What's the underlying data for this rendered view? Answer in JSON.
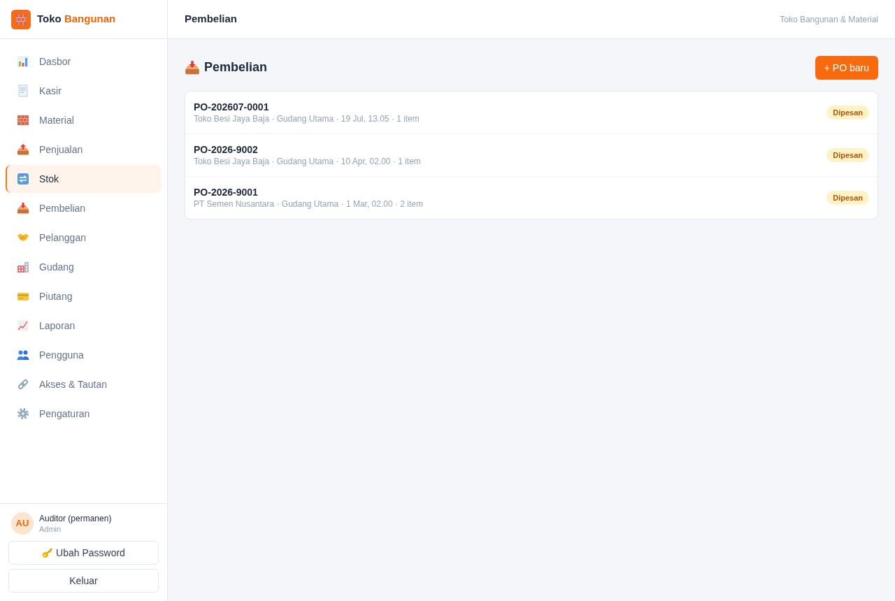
{
  "brand": {
    "name": "Toko",
    "accent": "Bangunan"
  },
  "sidebar": {
    "items": [
      {
        "label": "Dasbor",
        "selected": false
      },
      {
        "label": "Kasir",
        "selected": false
      },
      {
        "label": "Material",
        "selected": false
      },
      {
        "label": "Penjualan",
        "selected": false
      },
      {
        "label": "Stok",
        "selected": true
      },
      {
        "label": "Pembelian",
        "selected": false
      },
      {
        "label": "Pelanggan",
        "selected": false
      },
      {
        "label": "Gudang",
        "selected": false
      },
      {
        "label": "Piutang",
        "selected": false
      },
      {
        "label": "Laporan",
        "selected": false
      },
      {
        "label": "Pengguna",
        "selected": false
      },
      {
        "label": "Akses & Tautan",
        "selected": false
      },
      {
        "label": "Pengaturan",
        "selected": false
      }
    ]
  },
  "user": {
    "initials": "AU",
    "name": "Auditor (permanen)",
    "role": "Admin"
  },
  "account_buttons": [
    {
      "kind": "password",
      "label": "Ubah Password"
    },
    {
      "kind": "logout",
      "label": "Keluar"
    }
  ],
  "header": {
    "title": "Pembelian",
    "subtitle": "Toko Bangunan & Material"
  },
  "page": {
    "title": "Pembelian",
    "new_button": "+ PO baru"
  },
  "orders": [
    {
      "number": "PO-202607-0001",
      "details": "Toko Besi Jaya Baja · Gudang Utama · 19 Jul, 13.05 · 1 item",
      "status": "Dipesan"
    },
    {
      "number": "PO-2026-9002",
      "details": "Toko Besi Jaya Baja · Gudang Utama · 10 Apr, 02.00 · 1 item",
      "status": "Dipesan"
    },
    {
      "number": "PO-2026-9001",
      "details": "PT Semen Nusantara · Gudang Utama · 1 Mar, 02.00 · 2 item",
      "status": "Dipesan"
    }
  ]
}
